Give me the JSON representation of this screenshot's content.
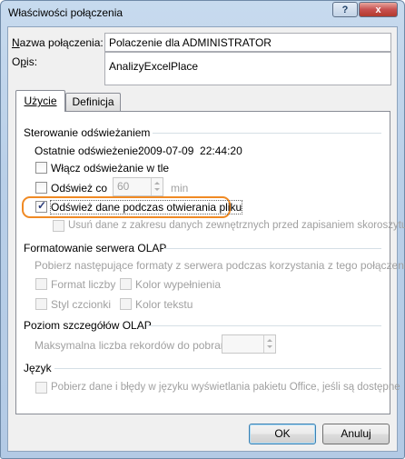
{
  "window": {
    "title": "Właściwości połączenia",
    "help_glyph": "?",
    "close_glyph": "x"
  },
  "fields": {
    "name_label": "Nazwa połączenia:",
    "name_value": "Polaczenie dla ADMINISTRATOR",
    "desc_label": "Opis:",
    "desc_value": "AnalizyExcelPlace"
  },
  "tabs": [
    {
      "label": "Użycie",
      "active": true
    },
    {
      "label": "Definicja",
      "active": false
    }
  ],
  "refresh": {
    "group_title": "Sterowanie odświeżaniem",
    "last_refresh_label": "Ostatnie odświeżenie:",
    "last_refresh_value": "2009-07-09  22:44:20",
    "background_label": "Włącz odświeżanie w tle",
    "background_checked": false,
    "every_label": "Odśwież co",
    "every_checked": false,
    "every_value": "60",
    "every_unit": "min",
    "on_open_label": "Odśwież dane podczas otwierania pliku",
    "on_open_checked": true,
    "remove_label": "Usuń dane z zakresu danych zewnętrznych przed zapisaniem skoroszytu",
    "remove_checked": false
  },
  "olap": {
    "group_title": "Formatowanie serwera OLAP",
    "description": "Pobierz następujące formaty z serwera podczas korzystania z tego połączenia:",
    "number_format": "Format liczby",
    "fill_color": "Kolor wypełnienia",
    "font_style": "Styl czcionki",
    "text_color": "Kolor tekstu"
  },
  "drill": {
    "group_title": "Poziom szczegółów OLAP",
    "max_records_label": "Maksymalna liczba rekordów do pobrania:",
    "max_records_value": ""
  },
  "language": {
    "group_title": "Język",
    "office_lang_label": "Pobierz dane i błędy w języku wyświetlania pakietu Office, jeśli są dostępne"
  },
  "buttons": {
    "ok": "OK",
    "cancel": "Anuluj"
  },
  "colors": {
    "highlight": "#f08a24",
    "close_button": "#c75050"
  }
}
